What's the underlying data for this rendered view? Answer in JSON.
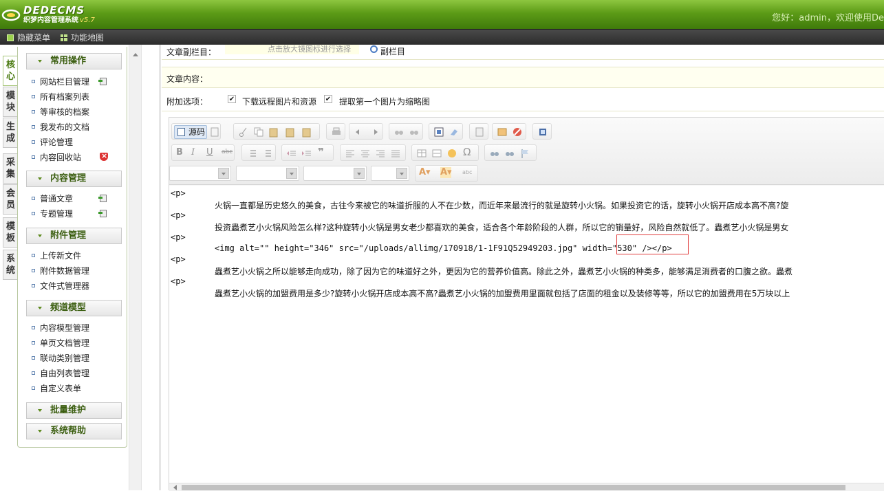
{
  "header": {
    "brand": "DEDECMS",
    "subtitle": "织梦内容管理系统",
    "version": "v5.7",
    "greeting": "您好：admin，欢迎使用De"
  },
  "navbar": {
    "hide_menu": "隐藏菜单",
    "site_map": "功能地图"
  },
  "vtabs": [
    "核心",
    "模块",
    "生成",
    "采集",
    "会员",
    "模板",
    "系统"
  ],
  "sidebar": {
    "groups": {
      "common": "常用操作",
      "content": "内容管理",
      "attach": "附件管理",
      "channel": "频道模型",
      "batch": "批量维护",
      "help": "系统帮助"
    },
    "common_items": [
      "网站栏目管理",
      "所有档案列表",
      "等审核的档案",
      "我发布的文档",
      "评论管理",
      "内容回收站"
    ],
    "content_items": [
      "普通文章",
      "专题管理"
    ],
    "attach_items": [
      "上传新文件",
      "附件数据管理",
      "文件式管理器"
    ],
    "channel_items": [
      "内容模型管理",
      "单页文档管理",
      "联动类别管理",
      "自由列表管理",
      "自定义表单"
    ]
  },
  "form": {
    "sub_column_label": "文章副栏目：",
    "sub_column_hint": "点击放大镜图标进行选择",
    "sub_column_button": "副栏目",
    "content_label": "文章内容：",
    "options_label": "附加选项：",
    "opt_download": "下载远程图片和资源",
    "opt_thumb": "提取第一个图片为缩略图",
    "opt_download_checked": true,
    "opt_thumb_checked": true
  },
  "editor": {
    "source_button": "源码",
    "tags": [
      "<p>",
      "<p>",
      "<p>",
      "<p>",
      "<p>"
    ],
    "lines": [
      "火锅一直都是历史悠久的美食，古往今来被它的味道折服的人不在少数，而近年来最流行的就是旋转小火锅。如果投资它的话，旋转小火锅开店成本高不高?旋",
      "投资蟲煮艺小火锅风险怎么样?这种旋转小火锅是男女老少都喜欢的美食，适合各个年龄阶段的人群，所以它的销量好，风险自然就低了。蟲煮艺小火锅是男女",
      "<img alt=\"\" height=\"346\" src=\"/uploads/allimg/170918/1-1F91Q52949203.jpg\" width=\"530\" /></p>",
      "蟲煮艺小火锅之所以能够走向成功，除了因为它的味道好之外，更因为它的营养价值高。除此之外，蟲煮艺小火锅的种类多，能够满足消费者的口腹之欲。蟲煮",
      "蟲煮艺小火锅的加盟费用是多少?旋转小火锅开店成本高不高?蟲煮艺小火锅的加盟费用里面就包括了店面的租金以及装修等等，所以它的加盟费用在5万块以上"
    ]
  },
  "colors": {
    "header_green": "#5c9b17",
    "highlight_red": "#e03a3a"
  }
}
